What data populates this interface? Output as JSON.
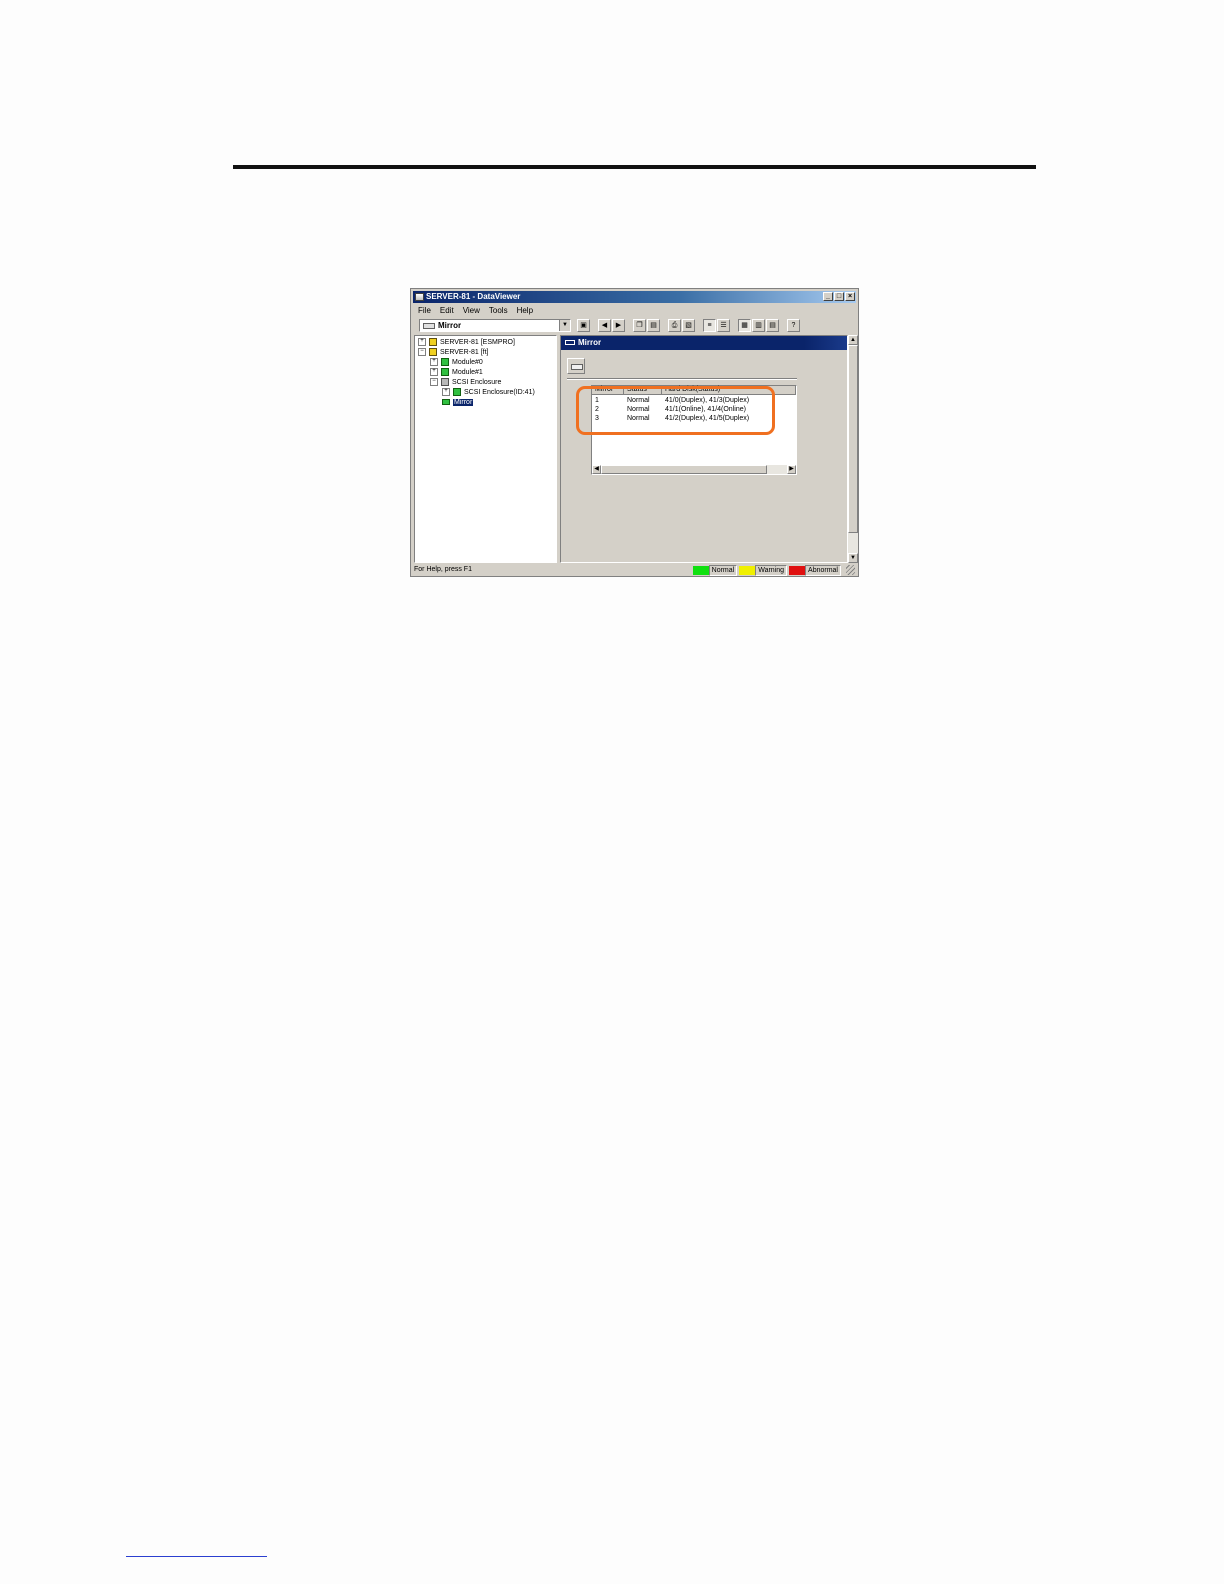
{
  "window": {
    "title": "SERVER-81 - DataViewer",
    "controls": {
      "minimize": "_",
      "maximize": "□",
      "close": "×"
    }
  },
  "menu": [
    "File",
    "Edit",
    "View",
    "Tools",
    "Help"
  ],
  "toolbar": {
    "selector_value": "Mirror"
  },
  "tree": {
    "nodes": [
      {
        "label": "SERVER-81 [ESMPRO]",
        "icon": "server-icon"
      },
      {
        "label": "SERVER-81 [ft]",
        "icon": "server-icon"
      },
      {
        "label": "Module#0",
        "icon": "module-icon"
      },
      {
        "label": "Module#1",
        "icon": "module-icon"
      },
      {
        "label": "SCSI Enclosure",
        "icon": "enclosure-icon"
      },
      {
        "label": "SCSI Enclosure(ID:41)",
        "icon": "enclosure-icon"
      },
      {
        "label": "Mirror",
        "icon": "mirror-icon",
        "selected": true
      }
    ]
  },
  "right_pane": {
    "header": "Mirror",
    "columns": [
      "Mirror",
      "Status",
      "Hard Disk(Status)"
    ],
    "rows": [
      [
        "1",
        "Normal",
        "41/0(Duplex), 41/3(Duplex)"
      ],
      [
        "2",
        "Normal",
        "41/1(Online), 41/4(Online)"
      ],
      [
        "3",
        "Normal",
        "41/2(Duplex), 41/5(Duplex)"
      ]
    ]
  },
  "status_bar": {
    "help_text": "For Help, press F1",
    "legend": [
      {
        "label": "Normal",
        "color": "#10e010"
      },
      {
        "label": "Warning",
        "color": "#f0f000"
      },
      {
        "label": "Abnormal",
        "color": "#e01010"
      }
    ]
  },
  "highlight_color": "#f07020"
}
